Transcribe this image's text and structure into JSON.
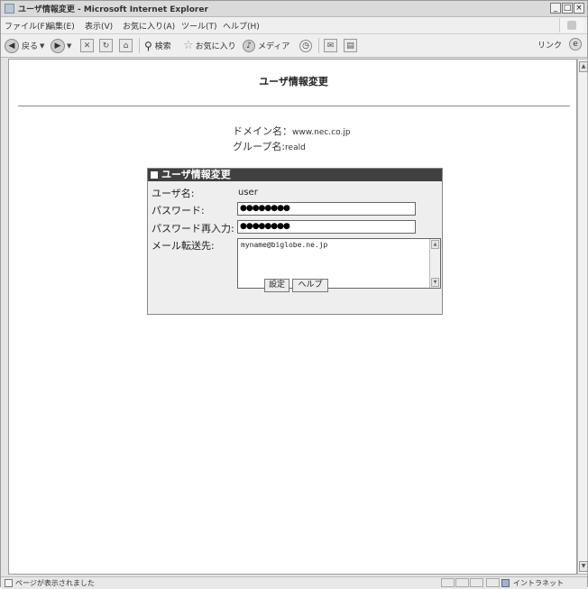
{
  "window": {
    "title": "ユーザ情報変更 - Microsoft Internet Explorer",
    "controls": {
      "minimize": "_",
      "maximize": "□",
      "close": "×"
    }
  },
  "menubar": {
    "items": [
      "ファイル(F)",
      "編集(E)",
      "表示(V)",
      "お気に入り(A)",
      "ツール(T)",
      "ヘルプ(H)"
    ]
  },
  "toolbar": {
    "back_label": "戻る",
    "search_label": "検索",
    "favorites_label": "お気に入り",
    "media_label": "メディア",
    "links_label": "リンク"
  },
  "page": {
    "title": "ユーザ情報変更",
    "domain_label": "ドメイン名：",
    "domain_value": "www.nec.co.jp",
    "group_label": "グループ名:",
    "group_value": "reald"
  },
  "form": {
    "header": "ユーザ情報変更",
    "username_label": "ユーザ名:",
    "username_value": "user",
    "password_label": "パスワード:",
    "password_value": "●●●●●●●●",
    "password_confirm_label": "パスワード再入力:",
    "password_confirm_value": "●●●●●●●●",
    "forward_label": "メール転送先:",
    "forward_value": "myname@biglobe.ne.jp",
    "submit_label": "設定",
    "help_label": "ヘルプ"
  },
  "statusbar": {
    "text": "ページが表示されました",
    "zone": "イントラネット"
  }
}
